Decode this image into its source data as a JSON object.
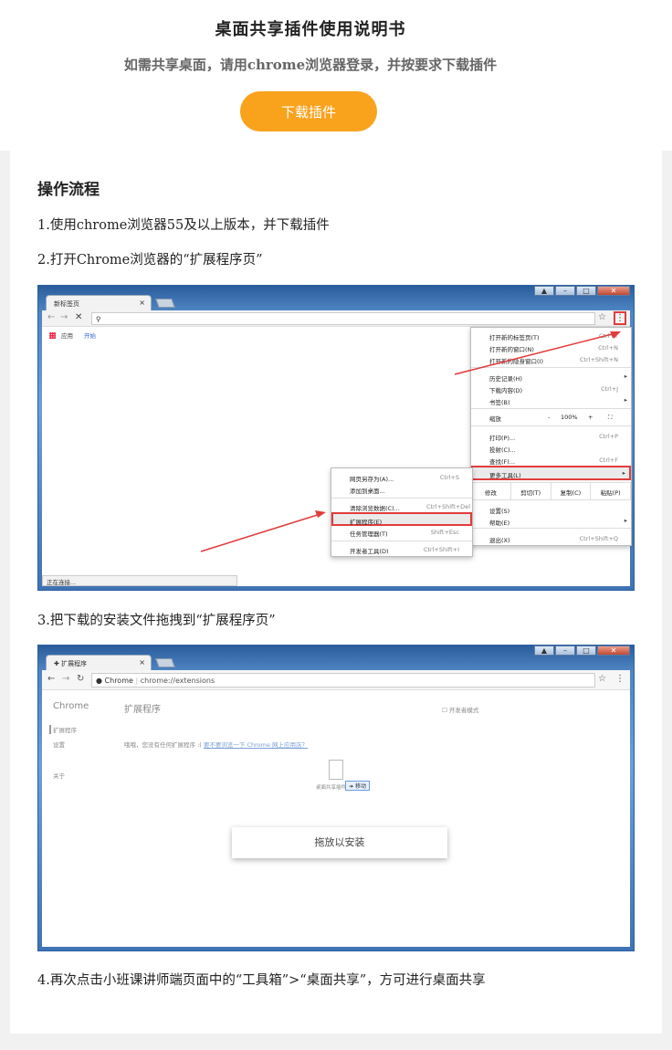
{
  "header": {
    "title": "桌面共享插件使用说明书",
    "subtitle": "如需共享桌面，请用chrome浏览器登录，并按要求下载插件",
    "download_label": "下载插件"
  },
  "content": {
    "section_title": "操作流程",
    "step1": "1.使用chrome浏览器55及以上版本，并下载插件",
    "step2": "2.打开Chrome浏览器的“扩展程序页”",
    "step3": "3.把下载的安装文件拖拽到“扩展程序页”",
    "step4": "4.再次点击小班课讲师端页面中的“工具箱”>“桌面共享”，方可进行桌面共享"
  },
  "shot1": {
    "tab_label": "新标签页",
    "tab_close": "×",
    "bookmark_apps": "应用",
    "bookmark_hint": "",
    "bookmark_link": "开始",
    "status": "正在连接...",
    "menu": {
      "new_tab": "打开新的标签页(T)",
      "new_tab_sc": "Ctrl+T",
      "new_window": "打开新的窗口(N)",
      "new_window_sc": "Ctrl+N",
      "incognito": "打开新的隐身窗口(I)",
      "incognito_sc": "Ctrl+Shift+N",
      "history": "历史记录(H)",
      "downloads": "下载内容(D)",
      "downloads_sc": "Ctrl+J",
      "bookmarks": "书签(B)",
      "zoom": "缩放",
      "zoom_minus": "-",
      "zoom_value": "100%",
      "zoom_plus": "+",
      "print": "打印(P)...",
      "print_sc": "Ctrl+P",
      "cast": "投射(C)...",
      "find": "查找(F)...",
      "find_sc": "Ctrl+F",
      "more_tools": "更多工具(L)",
      "edit": "修改",
      "cut": "剪切(T)",
      "copy": "复制(C)",
      "paste": "粘贴(P)",
      "settings": "设置(S)",
      "help": "帮助(E)",
      "exit": "退出(X)",
      "exit_sc": "Ctrl+Shift+Q"
    },
    "submenu": {
      "save_page": "网页另存为(A)...",
      "save_page_sc": "Ctrl+S",
      "add_desktop": "添加到桌面...",
      "clear_data": "清除浏览数据(C)...",
      "clear_data_sc": "Ctrl+Shift+Del",
      "extensions": "扩展程序(E)",
      "task_manager": "任务管理器(T)",
      "task_manager_sc": "Shift+Esc",
      "dev_tools": "开发者工具(D)",
      "dev_tools_sc": "Ctrl+Shift+I"
    }
  },
  "shot2": {
    "tab_label": "扩展程序",
    "tab_close": "×",
    "address_brand": "Chrome",
    "address_url": "chrome://extensions",
    "sidebar_title": "Chrome",
    "sidebar_ext": "扩展程序",
    "sidebar_settings": "设置",
    "sidebar_about": "关于",
    "page_title": "扩展程序",
    "dev_mode": "开发者模式",
    "empty_msg": "哦哦，您没有任何扩展程序 :(",
    "empty_link": "要不要浏览一下 Chrome 网上应用店？",
    "file_label": "桌面共享插件",
    "move_badge": "移动",
    "drop_label": "拖放以安装"
  },
  "colors": {
    "accent": "#f9a21b",
    "highlight_red": "#e23b3b",
    "win_blue": "#4d84c2"
  }
}
